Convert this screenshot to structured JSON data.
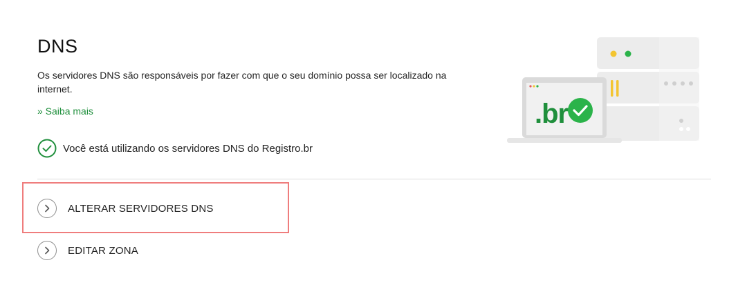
{
  "section": {
    "title": "DNS",
    "description": "Os servidores DNS são responsáveis por fazer com que o seu domínio possa ser localizado na internet.",
    "learn_more": "» Saiba mais",
    "status_text": "Você está utilizando os servidores DNS do Registro.br"
  },
  "actions": {
    "change_servers": "ALTERAR SERVIDORES DNS",
    "edit_zone": "EDITAR ZONA"
  },
  "illustration": {
    "logo_text": ".br"
  },
  "colors": {
    "accent_green": "#1f8f3c",
    "highlight_border": "#ef7d7d",
    "server_yellow": "#f3c531"
  },
  "icons": {
    "status": "check-circle-icon",
    "action": "chevron-right-icon"
  }
}
